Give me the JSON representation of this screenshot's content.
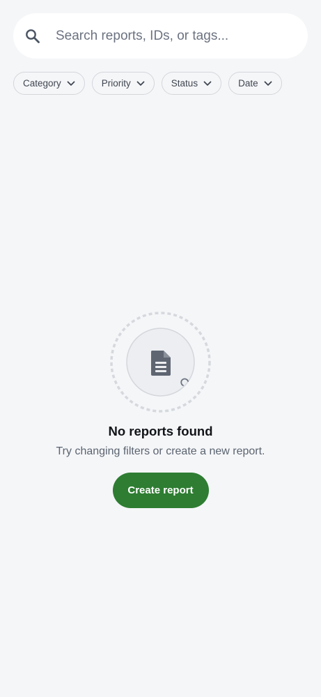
{
  "search": {
    "placeholder": "Search reports, IDs, or tags...",
    "icon": "search-icon"
  },
  "filters": [
    {
      "label": "Category",
      "icon": "chevron-down-icon"
    },
    {
      "label": "Priority",
      "icon": "chevron-down-icon"
    },
    {
      "label": "Status",
      "icon": "chevron-down-icon"
    },
    {
      "label": "Date",
      "icon": "chevron-down-icon"
    }
  ],
  "empty_state": {
    "icon": "document-icon",
    "title": "No reports found",
    "subtitle": "Try changing filters or create a new report.",
    "button_label": "Create report"
  },
  "colors": {
    "background": "#f5f6f8",
    "accent": "#2e7d32",
    "chip_border": "#d3d6db"
  }
}
